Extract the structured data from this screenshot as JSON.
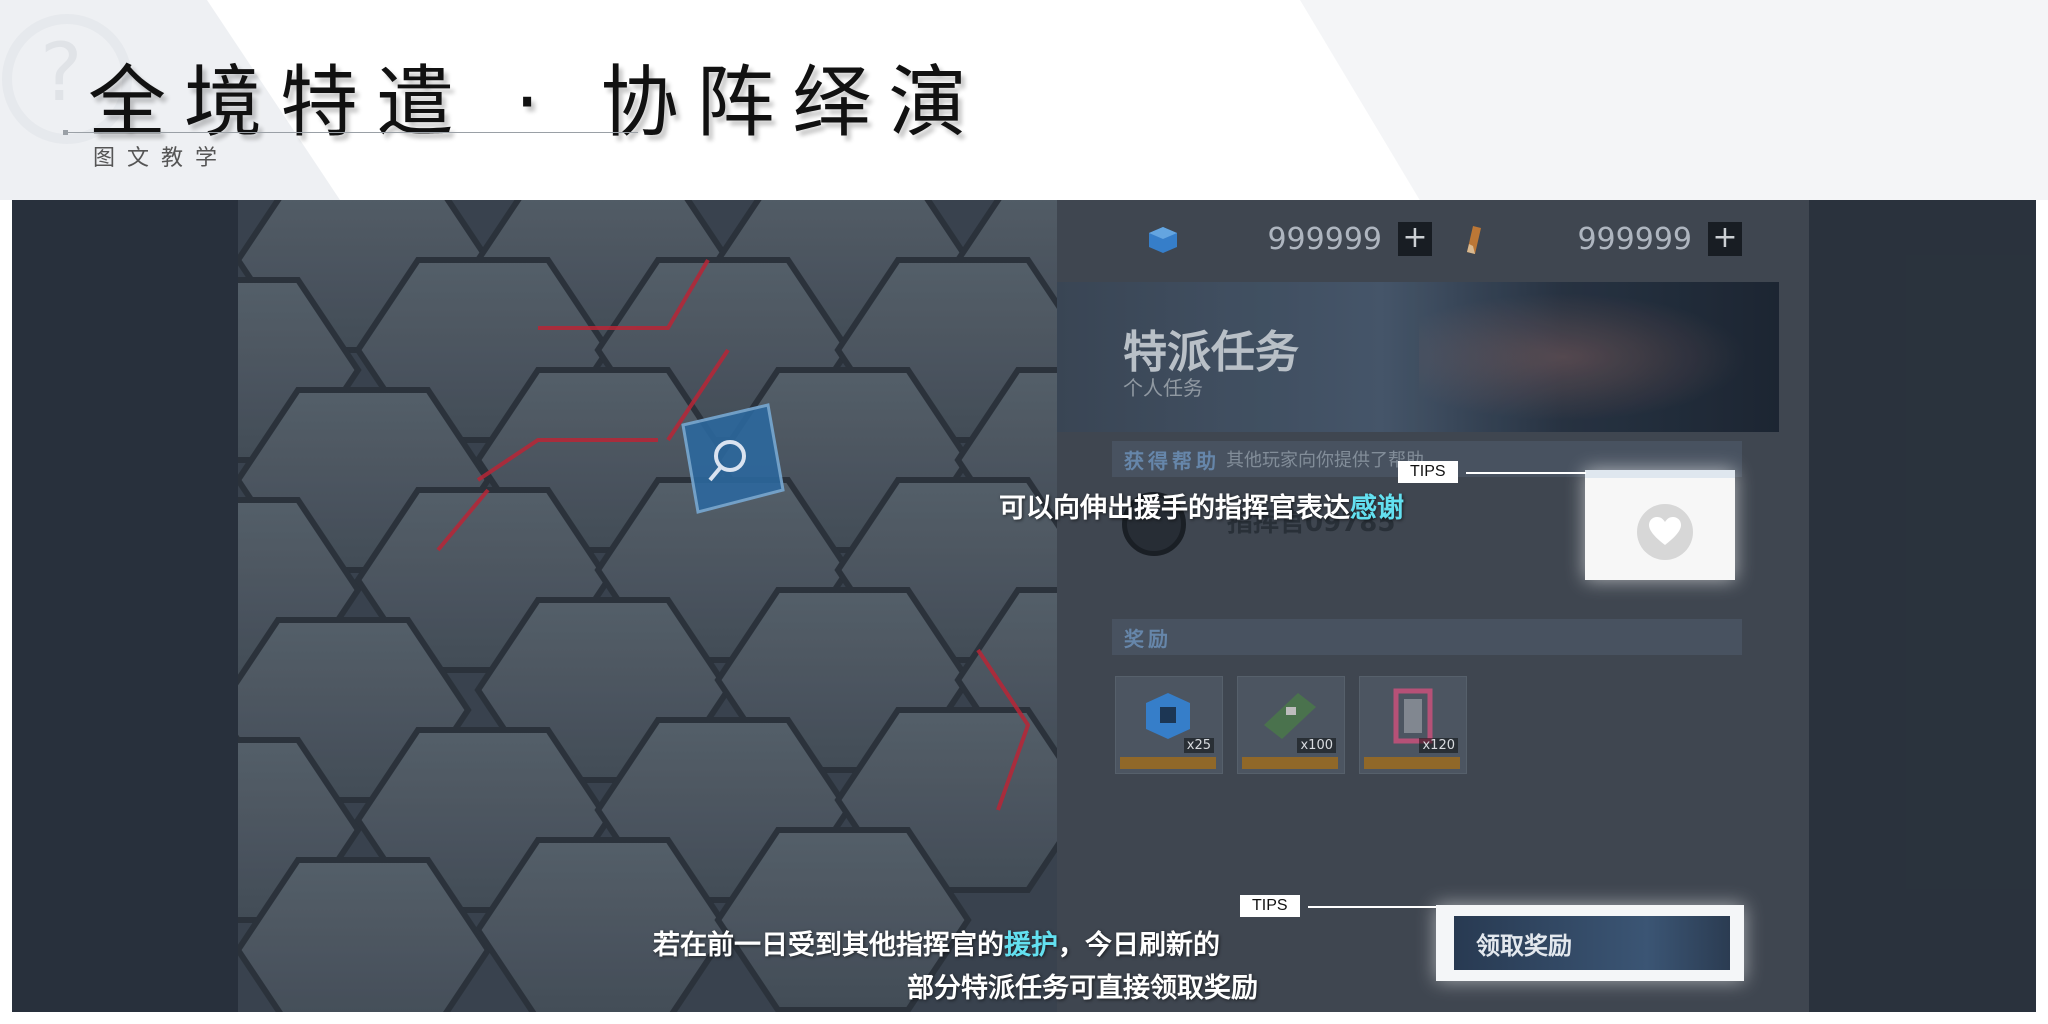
{
  "header": {
    "title": "全境特遣 · 协阵绎演",
    "subtitle": "图文教学"
  },
  "resources": [
    {
      "icon": "blue-cube-icon",
      "value": "999999",
      "plus": "+"
    },
    {
      "icon": "brush-icon",
      "value": "999999",
      "plus": "+"
    }
  ],
  "banner": {
    "title": "特派任务",
    "subtitle": "个人任务"
  },
  "help_section": {
    "label": "获得帮助",
    "description": "其他玩家向你提供了帮助",
    "helper_name": "指挥官09785"
  },
  "reward_section": {
    "label": "奖励",
    "items": [
      {
        "name": "blue-cube-item",
        "qty": "x25"
      },
      {
        "name": "circuit-board-item",
        "qty": "x100"
      },
      {
        "name": "pink-frame-item",
        "qty": "x120"
      }
    ]
  },
  "claim_button": "领取奖励",
  "tips": [
    {
      "tag": "TIPS",
      "text_main": "可以向伸出援手的指挥官表达",
      "text_highlight": "感谢"
    },
    {
      "tag": "TIPS",
      "line1_pre": "若在前一日受到其他指挥官的",
      "line1_highlight": "援护",
      "line1_post": "，今日刷新的",
      "line2": "部分特派任务可直接领取奖励"
    }
  ],
  "colors": {
    "highlight": "#63e0f0",
    "panel": "#434b55",
    "background": "#2b3440"
  }
}
